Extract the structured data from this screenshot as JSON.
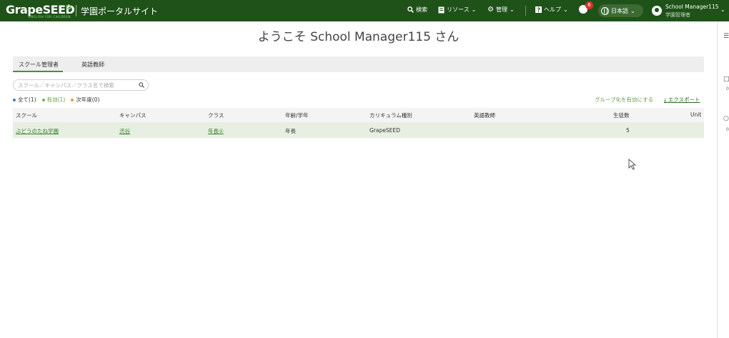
{
  "header": {
    "logo_text": "GrapeSEED",
    "logo_tagline": "ENGLISH FOR CHILDREN",
    "portal_title": "学園ポータルサイト",
    "nav": {
      "search": "検索",
      "resources": "リソース",
      "admin": "管理",
      "help": "ヘルプ"
    },
    "notification_count": "6",
    "language": "日本語",
    "user_name": "School Manager115",
    "user_role": "学園管理者"
  },
  "welcome": "ようこそ School Manager115 さん",
  "tabs": [
    {
      "label": "スクール管理者",
      "active": true
    },
    {
      "label": "英語教師",
      "active": false
    }
  ],
  "search": {
    "placeholder": "スクール／キャンパス／クラス名で検索"
  },
  "filters": [
    {
      "label": "全て(1)",
      "color": "#4a7db8"
    },
    {
      "label": "有効(1)",
      "color": "#7cb342"
    },
    {
      "label": "次年度(0)",
      "color": "#e0a030"
    }
  ],
  "actions": {
    "group": "グループ化を有効にする",
    "export": "エクスポート"
  },
  "table": {
    "columns": [
      "スクール",
      "キャンパス",
      "クラス",
      "年齢/学年",
      "カリキュラム種別",
      "英語教師",
      "生徒数",
      "Unit"
    ],
    "rows": [
      {
        "school": "ぶどうのたね学園",
        "campus": "渋谷",
        "class": "年長①",
        "age": "年長",
        "curriculum": "GrapeSEED",
        "teacher": "",
        "students": "5",
        "unit": ""
      }
    ]
  },
  "rail": {
    "count_a": "0",
    "count_b": "0"
  }
}
